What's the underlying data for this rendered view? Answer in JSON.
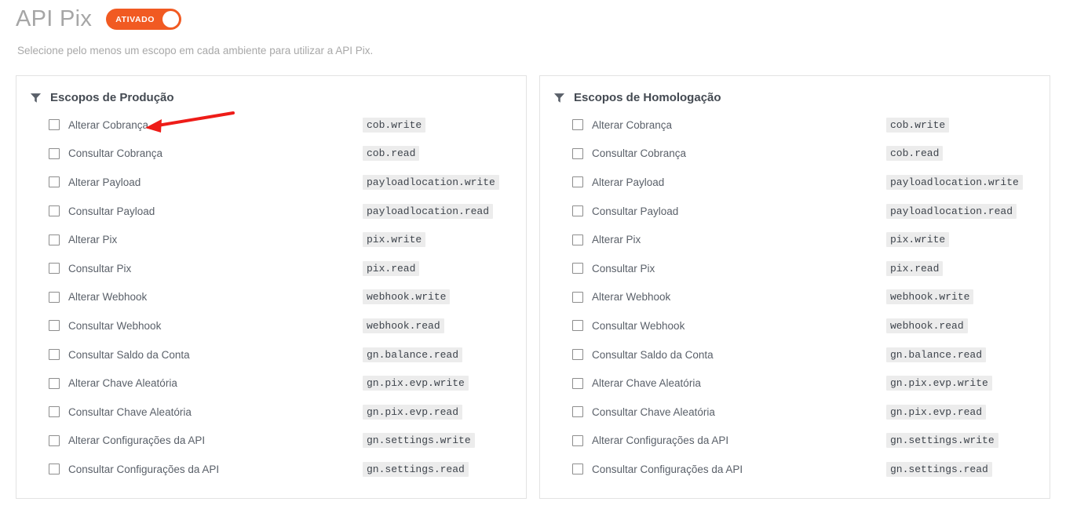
{
  "header": {
    "title": "API Pix",
    "toggle_label": "ATIVADO",
    "toggle_state": "on",
    "accent_color": "#f15a22"
  },
  "subtitle": "Selecione pelo menos um escopo em cada ambiente para utilizar a API Pix.",
  "panels": [
    {
      "id": "producao",
      "icon": "funnel-icon",
      "title": "Escopos de Produção",
      "scopes": [
        {
          "label": "Alterar Cobrança",
          "badge": "cob.write",
          "checked": false
        },
        {
          "label": "Consultar Cobrança",
          "badge": "cob.read",
          "checked": false
        },
        {
          "label": "Alterar Payload",
          "badge": "payloadlocation.write",
          "checked": false
        },
        {
          "label": "Consultar Payload",
          "badge": "payloadlocation.read",
          "checked": false
        },
        {
          "label": "Alterar Pix",
          "badge": "pix.write",
          "checked": false
        },
        {
          "label": "Consultar Pix",
          "badge": "pix.read",
          "checked": false
        },
        {
          "label": "Alterar Webhook",
          "badge": "webhook.write",
          "checked": false
        },
        {
          "label": "Consultar Webhook",
          "badge": "webhook.read",
          "checked": false
        },
        {
          "label": "Consultar Saldo da Conta",
          "badge": "gn.balance.read",
          "checked": false
        },
        {
          "label": "Alterar Chave Aleatória",
          "badge": "gn.pix.evp.write",
          "checked": false
        },
        {
          "label": "Consultar Chave Aleatória",
          "badge": "gn.pix.evp.read",
          "checked": false
        },
        {
          "label": "Alterar Configurações da API",
          "badge": "gn.settings.write",
          "checked": false
        },
        {
          "label": "Consultar Configurações da API",
          "badge": "gn.settings.read",
          "checked": false
        }
      ]
    },
    {
      "id": "homologacao",
      "icon": "funnel-icon",
      "title": "Escopos de Homologação",
      "scopes": [
        {
          "label": "Alterar Cobrança",
          "badge": "cob.write",
          "checked": false
        },
        {
          "label": "Consultar Cobrança",
          "badge": "cob.read",
          "checked": false
        },
        {
          "label": "Alterar Payload",
          "badge": "payloadlocation.write",
          "checked": false
        },
        {
          "label": "Consultar Payload",
          "badge": "payloadlocation.read",
          "checked": false
        },
        {
          "label": "Alterar Pix",
          "badge": "pix.write",
          "checked": false
        },
        {
          "label": "Consultar Pix",
          "badge": "pix.read",
          "checked": false
        },
        {
          "label": "Alterar Webhook",
          "badge": "webhook.write",
          "checked": false
        },
        {
          "label": "Consultar Webhook",
          "badge": "webhook.read",
          "checked": false
        },
        {
          "label": "Consultar Saldo da Conta",
          "badge": "gn.balance.read",
          "checked": false
        },
        {
          "label": "Alterar Chave Aleatória",
          "badge": "gn.pix.evp.write",
          "checked": false
        },
        {
          "label": "Consultar Chave Aleatória",
          "badge": "gn.pix.evp.read",
          "checked": false
        },
        {
          "label": "Alterar Configurações da API",
          "badge": "gn.settings.write",
          "checked": false
        },
        {
          "label": "Consultar Configurações da API",
          "badge": "gn.settings.read",
          "checked": false
        }
      ]
    }
  ],
  "annotation": {
    "type": "arrow",
    "color": "#ee1c18",
    "points_to": "Alterar Cobrança"
  }
}
